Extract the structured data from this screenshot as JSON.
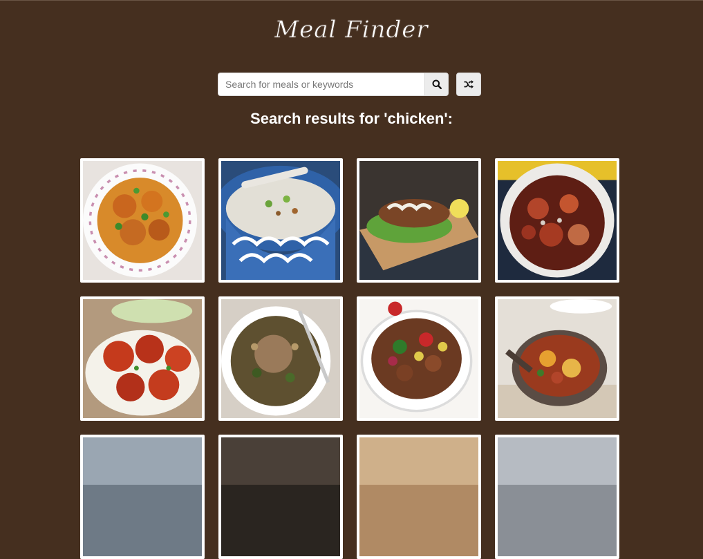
{
  "header": {
    "logo_text": "Meal Finder"
  },
  "search": {
    "placeholder": "Search for meals or keywords",
    "value": ""
  },
  "icons": {
    "search_button": "search-icon",
    "random_button": "shuffle-icon"
  },
  "results": {
    "heading": "Search results for 'chicken':"
  },
  "meals": [
    {
      "thumb": "curry-bowl-dish"
    },
    {
      "thumb": "congee-blue-bowl-dish"
    },
    {
      "thumb": "grilled-chicken-board-dish"
    },
    {
      "thumb": "casserole-pot-dish"
    },
    {
      "thumb": "tandoori-platter-dish"
    },
    {
      "thumb": "rice-chicken-plate-dish"
    },
    {
      "thumb": "stir-fry-bowl-dish"
    },
    {
      "thumb": "stew-skillet-dish"
    },
    {
      "thumb": "partially-visible-dish"
    },
    {
      "thumb": "partially-visible-dish"
    },
    {
      "thumb": "partially-visible-dish"
    },
    {
      "thumb": "partially-visible-dish"
    }
  ],
  "colors": {
    "background": "#452f1f",
    "card_border": "#ffffff",
    "button_bg": "#ececec",
    "text": "#ffffff"
  }
}
